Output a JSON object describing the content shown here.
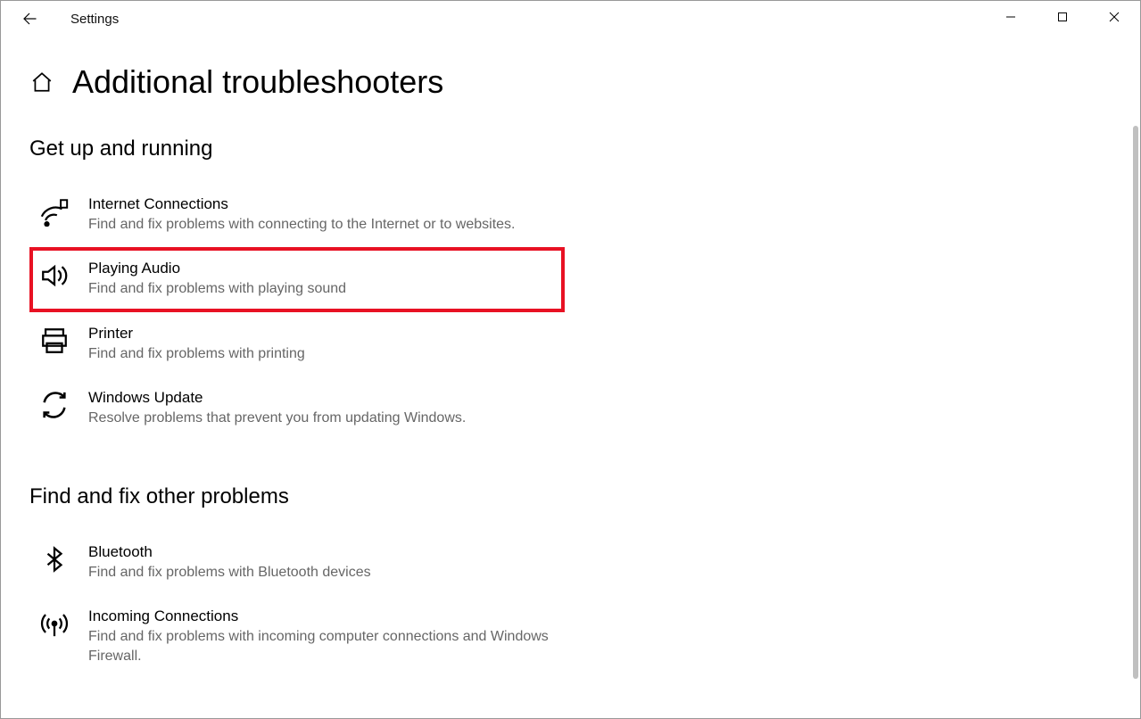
{
  "window": {
    "title": "Settings"
  },
  "page": {
    "title": "Additional troubleshooters"
  },
  "section1": {
    "title": "Get up and running"
  },
  "section2": {
    "title": "Find and fix other problems"
  },
  "troubleshooters1": [
    {
      "title": "Internet Connections",
      "desc": "Find and fix problems with connecting to the Internet or to websites."
    },
    {
      "title": "Playing Audio",
      "desc": "Find and fix problems with playing sound"
    },
    {
      "title": "Printer",
      "desc": "Find and fix problems with printing"
    },
    {
      "title": "Windows Update",
      "desc": "Resolve problems that prevent you from updating Windows."
    }
  ],
  "troubleshooters2": [
    {
      "title": "Bluetooth",
      "desc": "Find and fix problems with Bluetooth devices"
    },
    {
      "title": "Incoming Connections",
      "desc": "Find and fix problems with incoming computer connections and Windows Firewall."
    }
  ]
}
